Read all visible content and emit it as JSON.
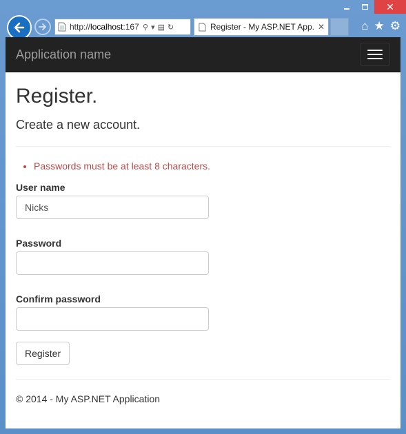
{
  "browser": {
    "url_prefix": "http://",
    "url_host": "localhost",
    "url_rest": ":167",
    "tab_title": "Register - My ASP.NET App...",
    "icons": [
      "back-icon",
      "forward-icon",
      "page-icon",
      "search-icon",
      "compat-icon",
      "refresh-icon",
      "home-icon",
      "favorites-star-icon",
      "settings-gear-icon"
    ],
    "accent": "#1b6fc2"
  },
  "navbar": {
    "brand": "Application name"
  },
  "page": {
    "title": "Register.",
    "subtitle": "Create a new account.",
    "errors": [
      "Passwords must be at least 8 characters."
    ],
    "error_color": "#b94a48"
  },
  "form": {
    "username_label": "User name",
    "username_value": "Nicks",
    "password_label": "Password",
    "password_value": "",
    "confirm_label": "Confirm password",
    "confirm_value": "",
    "submit_label": "Register"
  },
  "footer": {
    "text": "© 2014 - My ASP.NET Application"
  }
}
